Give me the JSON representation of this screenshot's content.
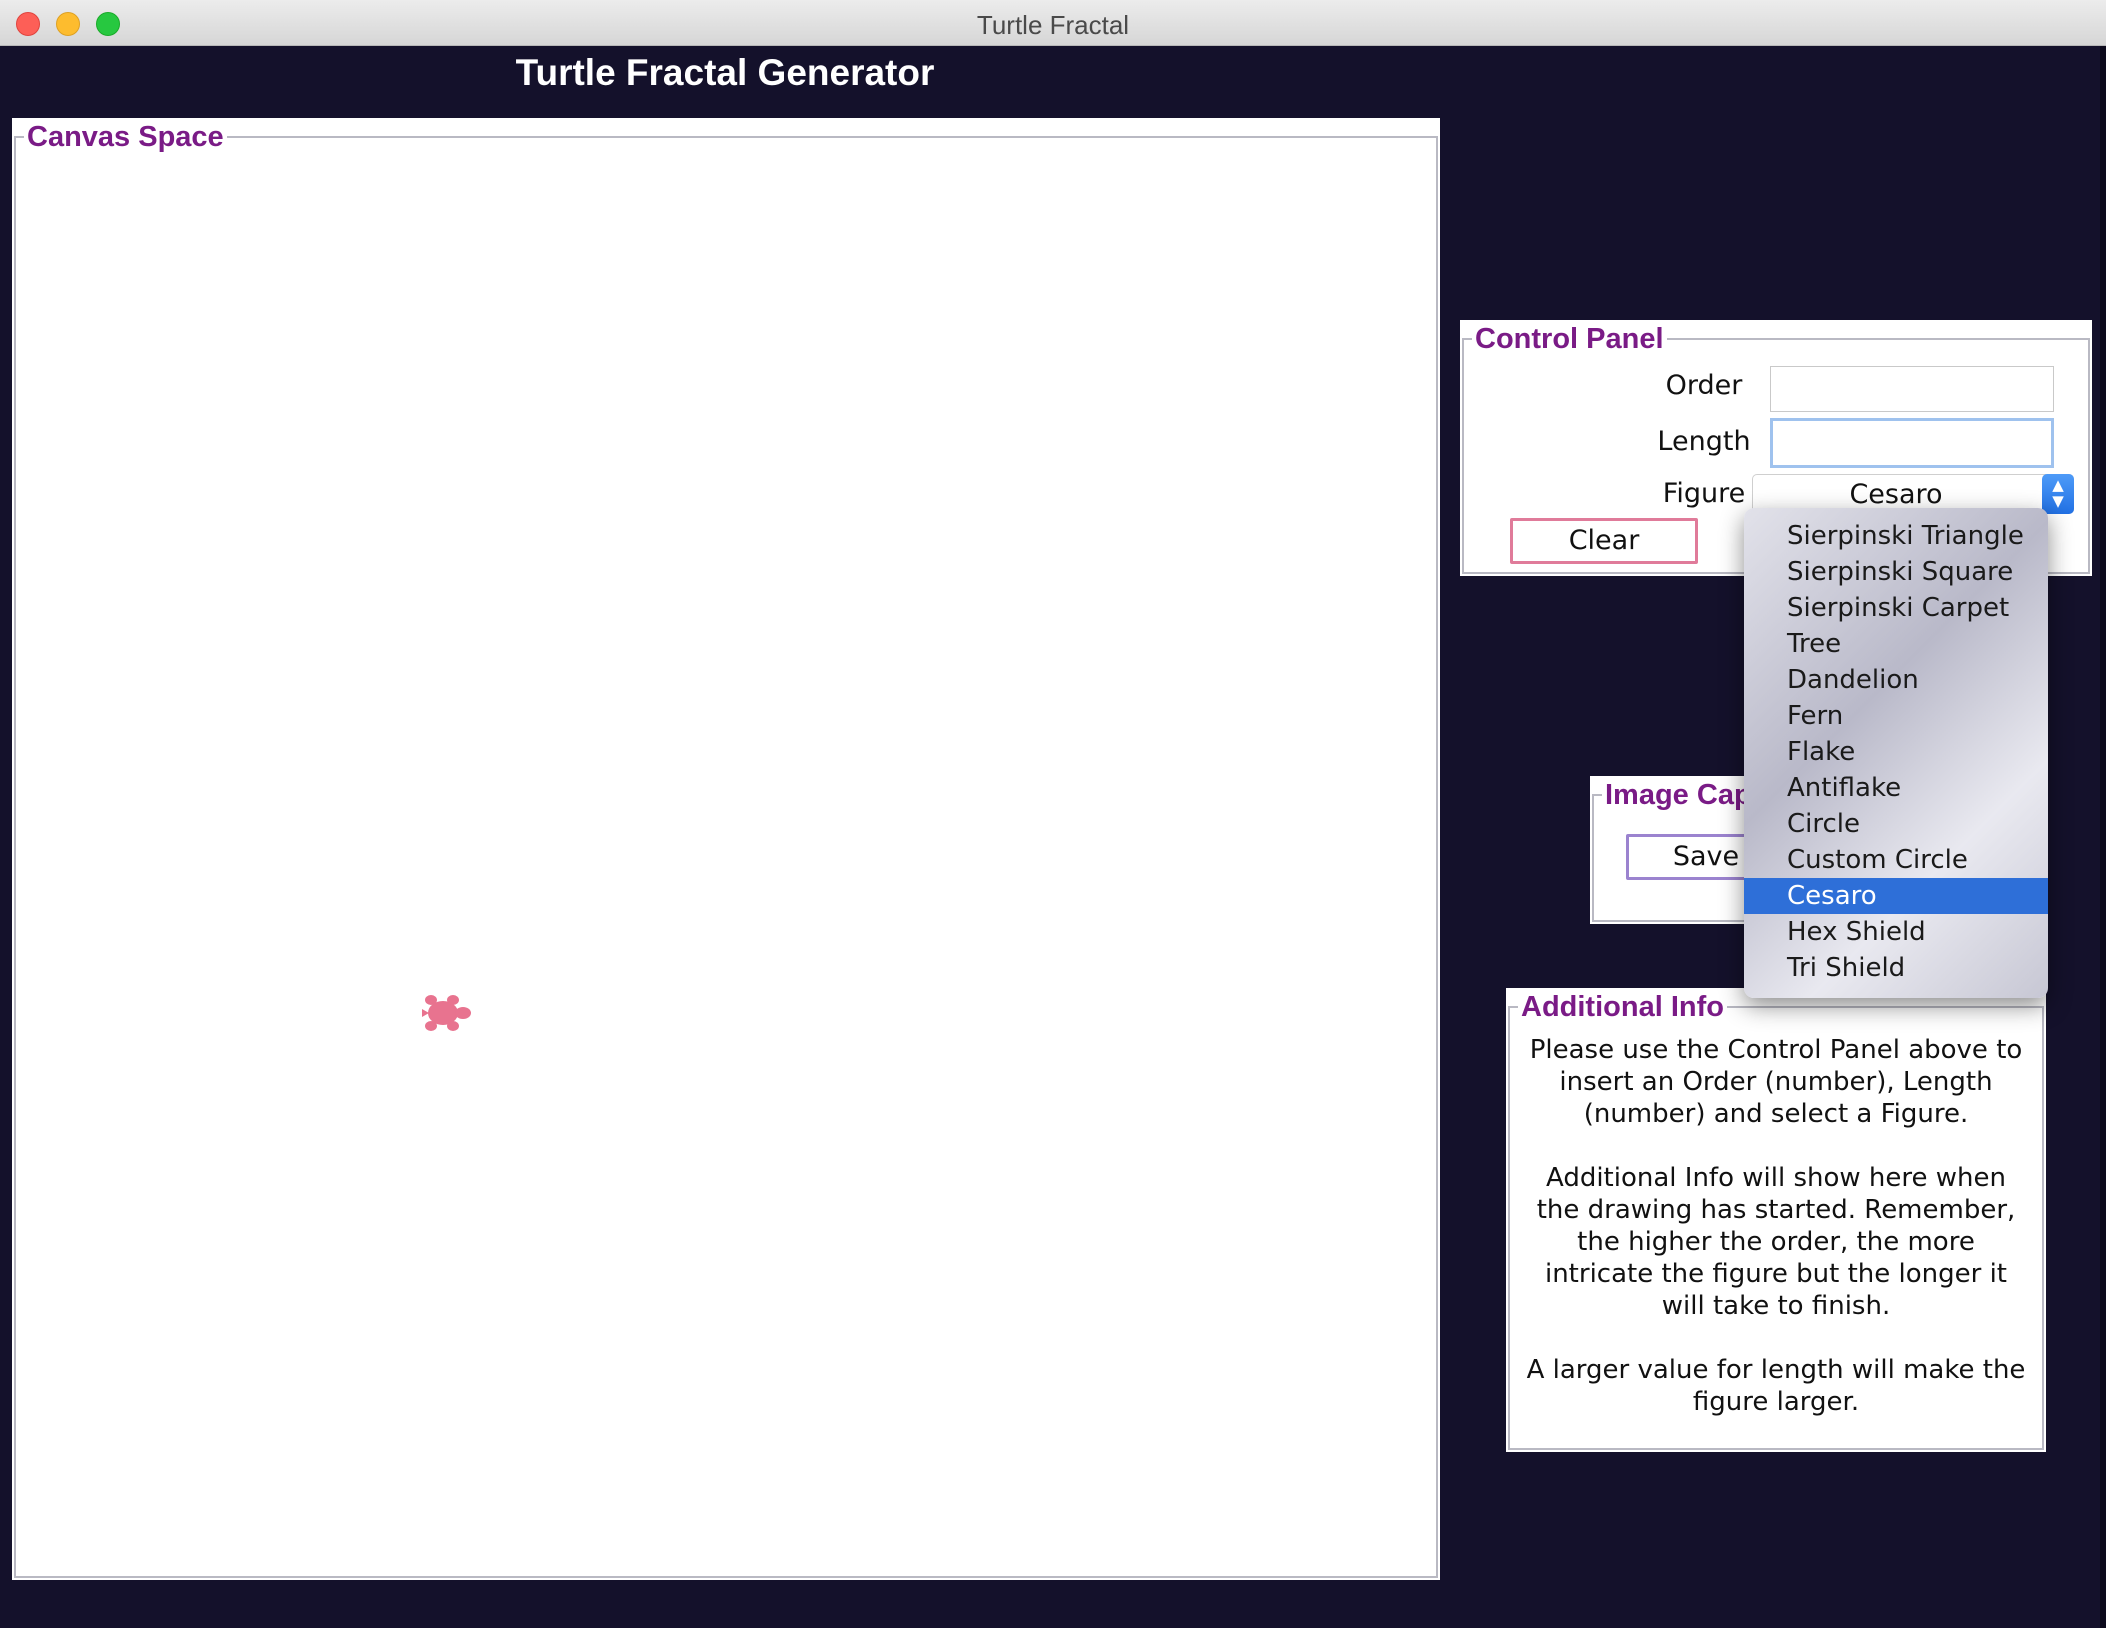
{
  "window": {
    "title": "Turtle Fractal"
  },
  "app": {
    "title": "Turtle Fractal Generator"
  },
  "canvas": {
    "label": "Canvas Space"
  },
  "control_panel": {
    "label": "Control Panel",
    "order_label": "Order",
    "order_value": "",
    "length_label": "Length",
    "length_value": "",
    "figure_label": "Figure",
    "figure_selected": "Cesaro",
    "clear_label": "Clear"
  },
  "image_capture": {
    "label": "Image Cap",
    "save_label": "Save"
  },
  "additional_info": {
    "label": "Additional Info",
    "para1": "Please use the Control Panel above to insert an Order (number), Length (number) and select a Figure.",
    "para2": "Additional Info will show here when the drawing has started. Remember, the higher the order, the more intricate the figure but the longer it will take to finish.",
    "para3": "A larger value for length will make the figure larger."
  },
  "figure_menu": {
    "items": [
      "Sierpinski Triangle",
      "Sierpinski Square",
      "Sierpinski Carpet",
      "Tree",
      "Dandelion",
      "Fern",
      "Flake",
      "Antiflake",
      "Circle",
      "Custom Circle",
      "Cesaro",
      "Hex Shield",
      "Tri Shield"
    ],
    "selected_index": 10
  },
  "colors": {
    "background": "#14112b",
    "frame_label": "#7a1b86",
    "turtle": "#e8738f",
    "menu_highlight": "#2e6fd8",
    "clear_border": "#e07b9a",
    "save_border": "#9b83cf"
  }
}
